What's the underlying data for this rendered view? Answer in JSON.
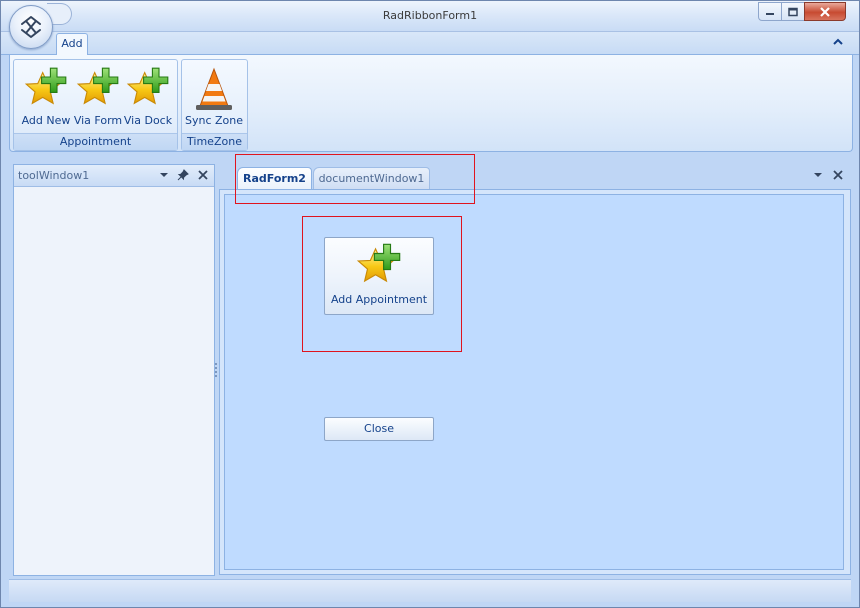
{
  "window": {
    "title": "RadRibbonForm1",
    "controls": [
      "minimize-icon",
      "maximize-icon",
      "close-icon"
    ]
  },
  "ribbon": {
    "tabs": [
      {
        "label": "Add",
        "selected": true
      }
    ],
    "groups": [
      {
        "label": "Appointment",
        "buttons": [
          {
            "label": "Add New",
            "icon": "star-plus-icon"
          },
          {
            "label": "Via Form",
            "icon": "star-plus-icon"
          },
          {
            "label": "Via Dock",
            "icon": "star-plus-icon"
          }
        ]
      },
      {
        "label": "TimeZone",
        "buttons": [
          {
            "label": "Sync Zone",
            "icon": "traffic-cone-icon"
          }
        ]
      }
    ]
  },
  "tool_window": {
    "title": "toolWindow1",
    "controls": [
      "dropdown-icon",
      "pin-icon",
      "close-icon"
    ]
  },
  "document_tabs": [
    {
      "label": "RadForm2",
      "selected": true
    },
    {
      "label": "documentWindow1",
      "selected": false
    }
  ],
  "form": {
    "add_appointment_label": "Add Appointment",
    "close_label": "Close"
  },
  "colors": {
    "highlight": "#e0141e",
    "text": "#15428b",
    "background": "#bfdbff"
  }
}
